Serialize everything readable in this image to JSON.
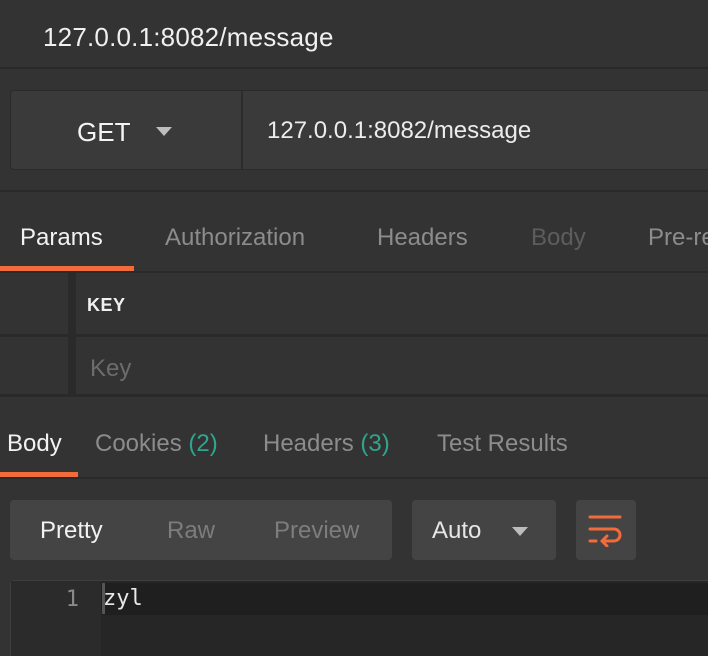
{
  "title_bar": {
    "title": "127.0.0.1:8082/message"
  },
  "request": {
    "method": "GET",
    "url": "127.0.0.1:8082/message"
  },
  "request_tabs": [
    {
      "label": "Params",
      "state": "active"
    },
    {
      "label": "Authorization",
      "state": "inactive"
    },
    {
      "label": "Headers",
      "state": "inactive"
    },
    {
      "label": "Body",
      "state": "disabled"
    },
    {
      "label": "Pre-re",
      "state": "inactive"
    }
  ],
  "params": {
    "key_header": "KEY",
    "key_placeholder": "Key"
  },
  "response_tabs": [
    {
      "label": "Body",
      "state": "active"
    },
    {
      "label": "Cookies",
      "count": "(2)",
      "state": "inactive"
    },
    {
      "label": "Headers",
      "count": "(3)",
      "state": "inactive"
    },
    {
      "label": "Test Results",
      "state": "inactive"
    }
  ],
  "response_view": {
    "options": [
      "Pretty",
      "Raw",
      "Preview"
    ],
    "selected": "Pretty",
    "format": "Auto",
    "wrap_icon": "wrap-lines-icon"
  },
  "editor": {
    "lines": [
      {
        "number": "1",
        "text": "zyl"
      }
    ]
  },
  "colors": {
    "accent": "#f26b3a",
    "count": "#2fa58d",
    "background": "#333333"
  }
}
